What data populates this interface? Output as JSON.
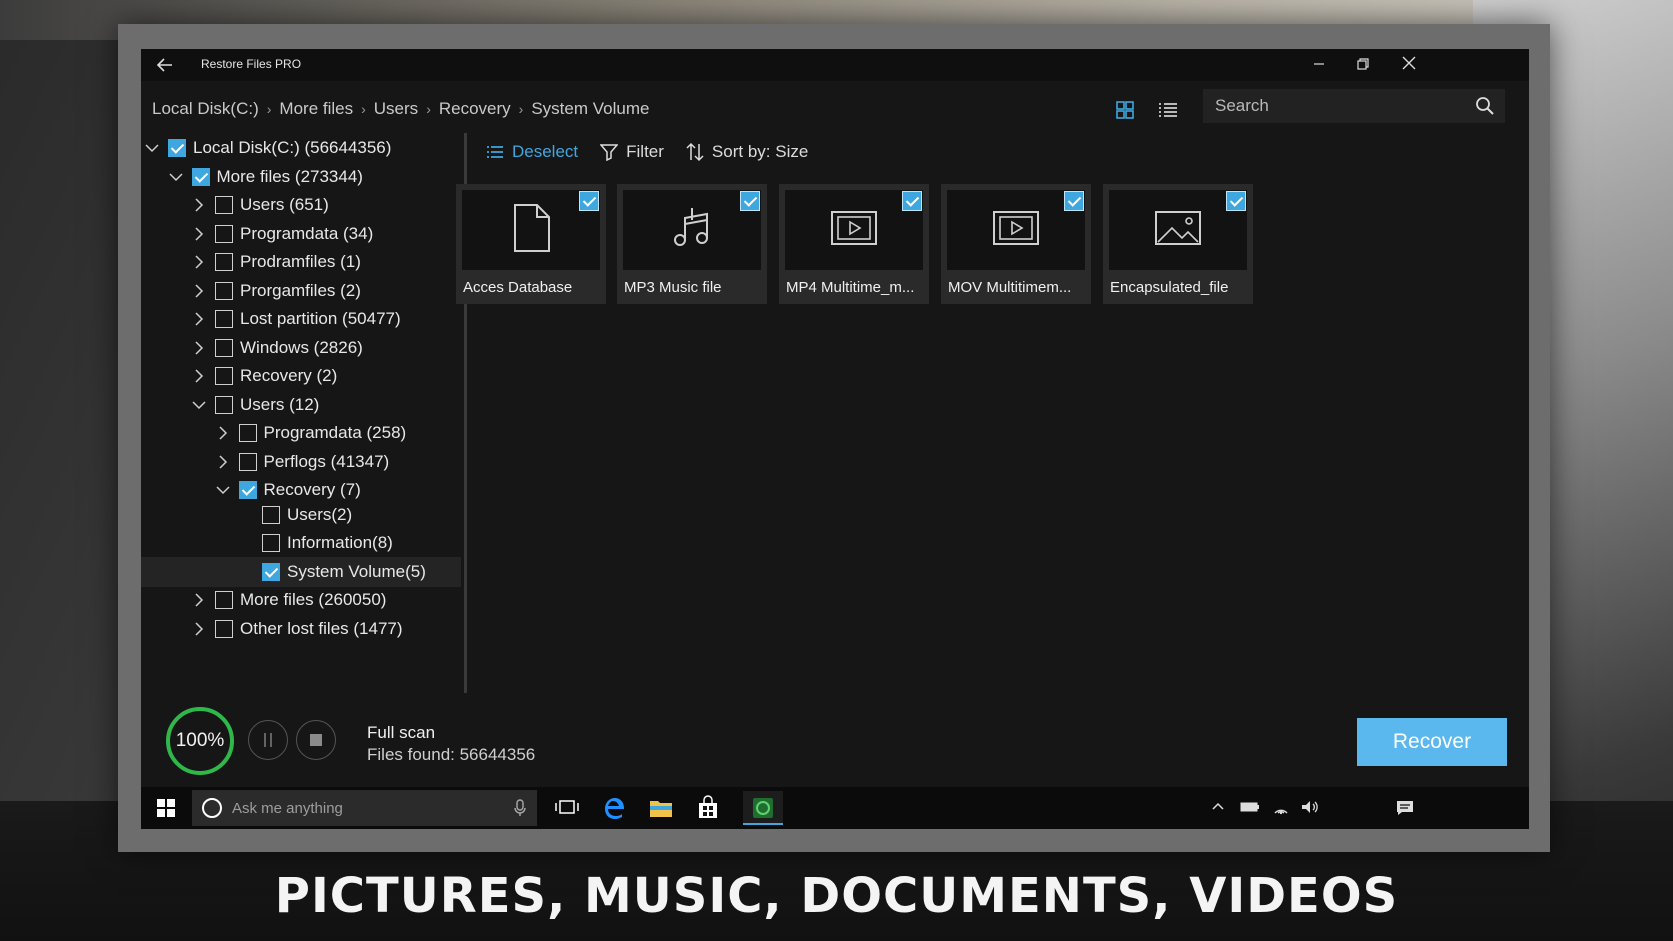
{
  "window": {
    "title": "Restore Files PRO"
  },
  "breadcrumb": [
    "Local Disk(C:)",
    "More files",
    "Users",
    "Recovery",
    "System Volume"
  ],
  "search": {
    "placeholder": "Search"
  },
  "tree": [
    {
      "label": "Local Disk(C:) (56644356)",
      "level": 0,
      "expander": "down",
      "checked": true
    },
    {
      "label": "More files (273344)",
      "level": 1,
      "expander": "down",
      "checked": true
    },
    {
      "label": "Users (651)",
      "level": 2,
      "expander": "right",
      "checked": false
    },
    {
      "label": "Programdata (34)",
      "level": 2,
      "expander": "right",
      "checked": false
    },
    {
      "label": "Prodramfiles (1)",
      "level": 2,
      "expander": "right",
      "checked": false
    },
    {
      "label": "Prorgamfiles (2)",
      "level": 2,
      "expander": "right",
      "checked": false
    },
    {
      "label": "Lost partition (50477)",
      "level": 2,
      "expander": "right",
      "checked": false
    },
    {
      "label": "Windows (2826)",
      "level": 2,
      "expander": "right",
      "checked": false
    },
    {
      "label": "Recovery (2)",
      "level": 2,
      "expander": "right",
      "checked": false
    },
    {
      "label": "Users (12)",
      "level": 2,
      "expander": "down",
      "checked": false
    },
    {
      "label": "Programdata (258)",
      "level": 3,
      "expander": "right",
      "checked": false
    },
    {
      "label": "Perflogs (41347)",
      "level": 3,
      "expander": "right",
      "checked": false
    },
    {
      "label": "Recovery (7)",
      "level": 3,
      "expander": "down",
      "checked": true
    },
    {
      "label": "Users(2)",
      "level": 4,
      "expander": "none",
      "checked": false
    },
    {
      "label": "Information(8)",
      "level": 4,
      "expander": "none",
      "checked": false
    },
    {
      "label": "System Volume(5)",
      "level": 4,
      "expander": "none",
      "checked": true,
      "selected": true
    },
    {
      "label": "More files (260050)",
      "level": 2,
      "expander": "right",
      "checked": false
    },
    {
      "label": "Other lost files (1477)",
      "level": 2,
      "expander": "right",
      "checked": false
    }
  ],
  "toolbar": {
    "deselect": "Deselect",
    "filter": "Filter",
    "sort": "Sort by: Size"
  },
  "files": [
    {
      "name": "Acces Database",
      "icon": "document-icon",
      "checked": true
    },
    {
      "name": "MP3 Music file",
      "icon": "music-icon",
      "checked": true
    },
    {
      "name": "MP4 Multitime_m...",
      "icon": "video-icon",
      "checked": true
    },
    {
      "name": "MOV Multitimem...",
      "icon": "video-icon",
      "checked": true
    },
    {
      "name": "Encapsulated_file",
      "icon": "image-icon",
      "checked": true
    }
  ],
  "status": {
    "progress_text": "100%",
    "progress": 1.0,
    "scan_type": "Full scan",
    "files_found": "Files found: 56644356"
  },
  "recover_label": "Recover",
  "taskbar": {
    "search_placeholder": "Ask me anything"
  },
  "caption": "PICTURES, MUSIC, DOCUMENTS, VIDEOS",
  "colors": {
    "accent": "#3fa7e0",
    "recover_button": "#5ab8ee",
    "progress_ring": "#2fb84a"
  }
}
